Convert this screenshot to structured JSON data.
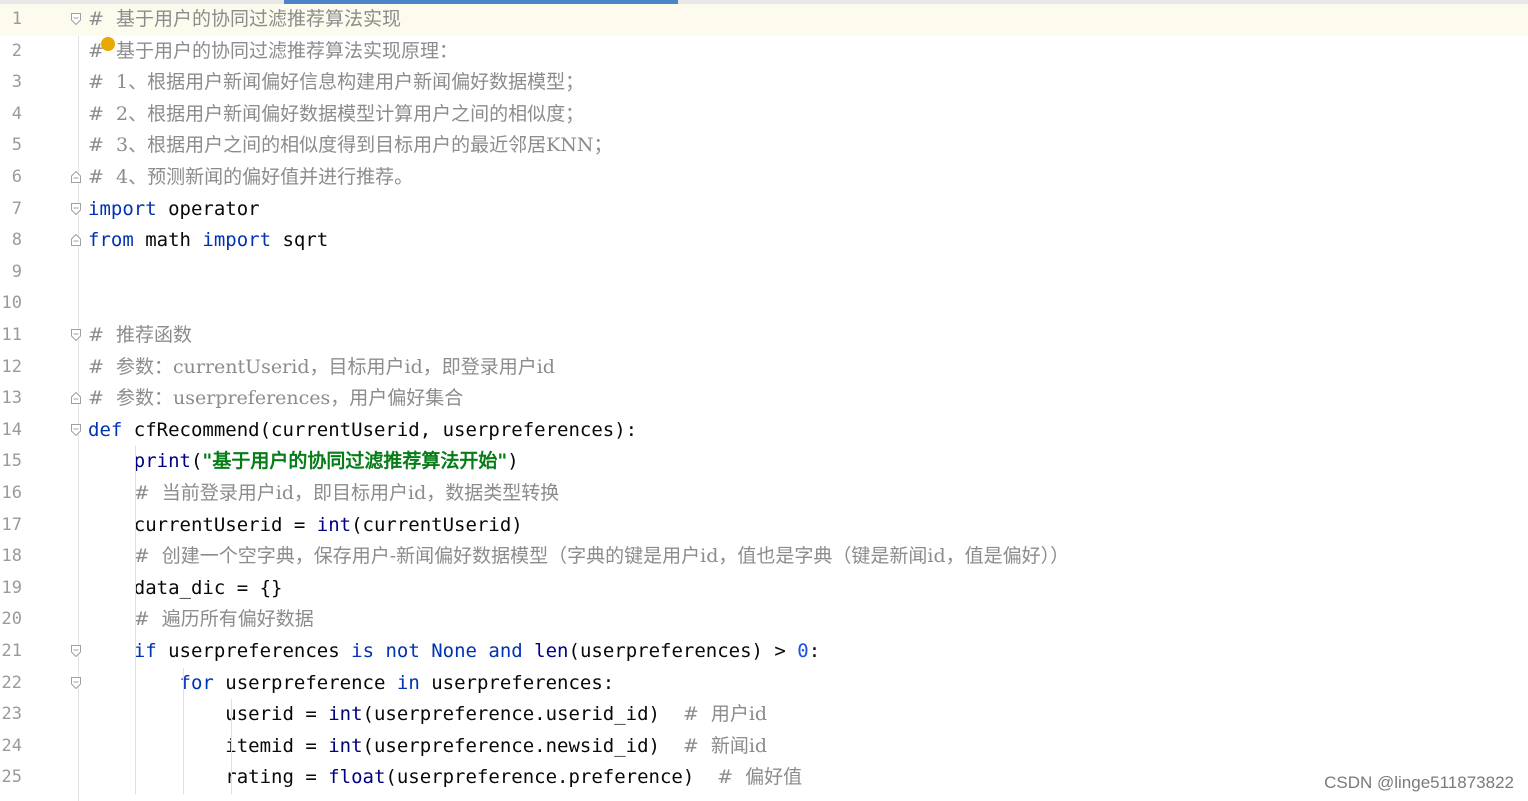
{
  "editor": {
    "watermark": "CSDN @linge511873822",
    "lines": [
      {
        "n": "1",
        "segs": [
          {
            "c": "cm",
            "t": "#  基于用户的协同过滤推荐算法实现"
          }
        ]
      },
      {
        "n": "2",
        "segs": [
          {
            "c": "cm",
            "t": "#  基于用户的协同过滤推荐算法实现原理："
          }
        ]
      },
      {
        "n": "3",
        "segs": [
          {
            "c": "cm",
            "t": "#  1、根据用户新闻偏好信息构建用户新闻偏好数据模型；"
          }
        ]
      },
      {
        "n": "4",
        "segs": [
          {
            "c": "cm",
            "t": "#  2、根据用户新闻偏好数据模型计算用户之间的相似度；"
          }
        ]
      },
      {
        "n": "5",
        "segs": [
          {
            "c": "cm",
            "t": "#  3、根据用户之间的相似度得到目标用户的最近邻居KNN；"
          }
        ]
      },
      {
        "n": "6",
        "segs": [
          {
            "c": "cm",
            "t": "#  4、预测新闻的偏好值并进行推荐。"
          }
        ]
      },
      {
        "n": "7",
        "segs": [
          {
            "c": "kw",
            "t": "import"
          },
          {
            "c": "",
            "t": " operator"
          }
        ]
      },
      {
        "n": "8",
        "segs": [
          {
            "c": "kw",
            "t": "from"
          },
          {
            "c": "",
            "t": " math "
          },
          {
            "c": "kw",
            "t": "import"
          },
          {
            "c": "",
            "t": " sqrt"
          }
        ]
      },
      {
        "n": "9",
        "segs": []
      },
      {
        "n": "10",
        "segs": []
      },
      {
        "n": "11",
        "segs": [
          {
            "c": "cm",
            "t": "#  推荐函数"
          }
        ]
      },
      {
        "n": "12",
        "segs": [
          {
            "c": "cm",
            "t": "#  参数：currentUserid，目标用户id，即登录用户id"
          }
        ]
      },
      {
        "n": "13",
        "segs": [
          {
            "c": "cm",
            "t": "#  参数：userpreferences，用户偏好集合"
          }
        ]
      },
      {
        "n": "14",
        "segs": [
          {
            "c": "kw",
            "t": "def"
          },
          {
            "c": "",
            "t": " cfRecommend(currentUserid, userpreferences):"
          }
        ]
      },
      {
        "n": "15",
        "segs": [
          {
            "c": "",
            "t": "    "
          },
          {
            "c": "bi",
            "t": "print"
          },
          {
            "c": "",
            "t": "("
          },
          {
            "c": "str",
            "t": "\"基于用户的协同过滤推荐算法开始\""
          },
          {
            "c": "",
            "t": ")"
          }
        ]
      },
      {
        "n": "16",
        "segs": [
          {
            "c": "",
            "t": "    "
          },
          {
            "c": "cm",
            "t": "#  当前登录用户id，即目标用户id，数据类型转换"
          }
        ]
      },
      {
        "n": "17",
        "segs": [
          {
            "c": "",
            "t": "    currentUserid = "
          },
          {
            "c": "bi",
            "t": "int"
          },
          {
            "c": "",
            "t": "(currentUserid)"
          }
        ]
      },
      {
        "n": "18",
        "segs": [
          {
            "c": "",
            "t": "    "
          },
          {
            "c": "cm",
            "t": "#  创建一个空字典，保存用户-新闻偏好数据模型（字典的键是用户id，值也是字典（键是新闻id，值是偏好））"
          }
        ]
      },
      {
        "n": "19",
        "segs": [
          {
            "c": "",
            "t": "    data_dic = {}"
          }
        ]
      },
      {
        "n": "20",
        "segs": [
          {
            "c": "",
            "t": "    "
          },
          {
            "c": "cm",
            "t": "#  遍历所有偏好数据"
          }
        ]
      },
      {
        "n": "21",
        "segs": [
          {
            "c": "",
            "t": "    "
          },
          {
            "c": "kw",
            "t": "if"
          },
          {
            "c": "",
            "t": " userpreferences "
          },
          {
            "c": "kw",
            "t": "is not None and"
          },
          {
            "c": "",
            "t": " "
          },
          {
            "c": "bi",
            "t": "len"
          },
          {
            "c": "",
            "t": "(userpreferences) > "
          },
          {
            "c": "num",
            "t": "0"
          },
          {
            "c": "",
            "t": ":"
          }
        ]
      },
      {
        "n": "22",
        "segs": [
          {
            "c": "",
            "t": "        "
          },
          {
            "c": "kw",
            "t": "for"
          },
          {
            "c": "",
            "t": " userpreference "
          },
          {
            "c": "kw",
            "t": "in"
          },
          {
            "c": "",
            "t": " userpreferences:"
          }
        ]
      },
      {
        "n": "23",
        "segs": [
          {
            "c": "",
            "t": "            userid = "
          },
          {
            "c": "bi",
            "t": "int"
          },
          {
            "c": "",
            "t": "(userpreference.userid_id)  "
          },
          {
            "c": "cm",
            "t": "#  用户id"
          }
        ]
      },
      {
        "n": "24",
        "segs": [
          {
            "c": "",
            "t": "            itemid = "
          },
          {
            "c": "bi",
            "t": "int"
          },
          {
            "c": "",
            "t": "(userpreference.newsid_id)  "
          },
          {
            "c": "cm",
            "t": "#  新闻id"
          }
        ]
      },
      {
        "n": "25",
        "segs": [
          {
            "c": "",
            "t": "            rating = "
          },
          {
            "c": "bi",
            "t": "float"
          },
          {
            "c": "",
            "t": "(userpreference.preference)  "
          },
          {
            "c": "cm",
            "t": "#  偏好值"
          }
        ]
      }
    ],
    "fold_open": [
      "1",
      "7",
      "11",
      "14",
      "21",
      "22"
    ],
    "fold_close": [
      "6",
      "8",
      "13"
    ]
  }
}
